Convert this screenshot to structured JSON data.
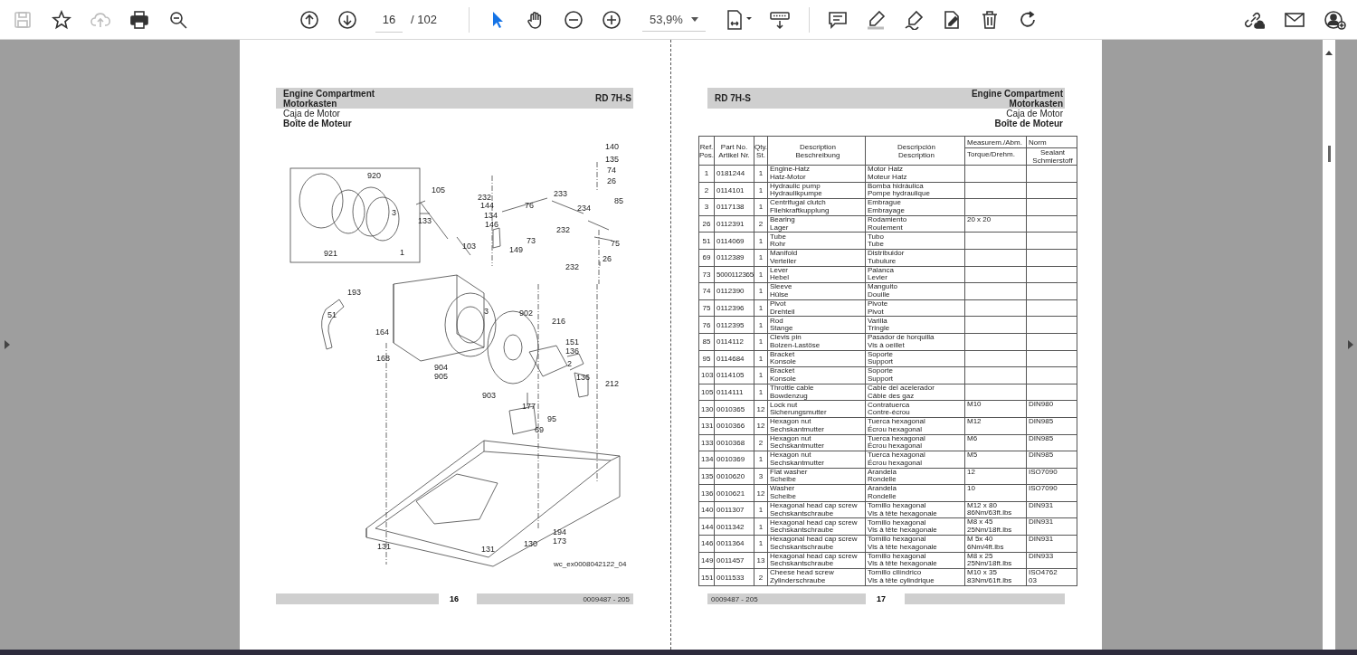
{
  "toolbar": {
    "file_tools": [
      {
        "disabled": true
      },
      {
        "disabled": false
      },
      {
        "disabled": true
      },
      {
        "disabled": false
      },
      {
        "disabled": false
      }
    ],
    "page_current": "16",
    "page_total": "/ 102",
    "pointer_tools": [
      {
        "selected": true
      },
      {
        "selected": false
      }
    ],
    "zoom": "53,9%"
  },
  "left_page": {
    "title_lines": [
      "Engine Compartment",
      "Motorkasten"
    ],
    "model": "RD 7H-S",
    "subtitle_lines": [
      "Caja de Motor",
      "Boîte de Moteur"
    ],
    "callouts": [
      "140",
      "135",
      "74",
      "26",
      "920",
      "105",
      "232",
      "144",
      "134",
      "146",
      "233",
      "76",
      "234",
      "85",
      "133",
      "3",
      "232",
      "73",
      "149",
      "75",
      "103",
      "921",
      "1",
      "26",
      "232",
      "193",
      "51",
      "3",
      "164",
      "902",
      "216",
      "151",
      "136",
      "2",
      "168",
      "904",
      "905",
      "136",
      "212",
      "903",
      "95",
      "177",
      "69",
      "194",
      "173",
      "131",
      "130",
      "131"
    ],
    "figure_id": "wc_ex0008042122_04",
    "page_number": "16",
    "doc_number": "0009487 - 205"
  },
  "right_page": {
    "model": "RD 7H-S",
    "title_lines": [
      "Engine Compartment",
      "Motorkasten"
    ],
    "subtitle_lines": [
      "Caja de Motor",
      "Boîte de Moteur"
    ],
    "table": {
      "columns": [
        [
          "Ref.",
          "Pos."
        ],
        [
          "Part No.",
          "Artikel Nr."
        ],
        [
          "Qty.",
          "St."
        ],
        [
          "Description",
          "Beschreibung"
        ],
        [
          "Descripción",
          "Description"
        ],
        [
          "Measurem./Abm.",
          "Torque/Drehm."
        ],
        [
          "Norm",
          "Sealant Schmierstoff"
        ]
      ],
      "rows": [
        {
          "ref": "1",
          "part": "0181244",
          "qty": "1",
          "desc": [
            "Engine-Hatz",
            "Hatz-Motor"
          ],
          "desc2": [
            "Motor Hatz",
            "Moteur Hatz"
          ],
          "meas": [],
          "norm": []
        },
        {
          "ref": "2",
          "part": "0114101",
          "qty": "1",
          "desc": [
            "Hydraulic pump",
            "Hydraulikpumpe"
          ],
          "desc2": [
            "Bomba hidráulica",
            "Pompe hydraulique"
          ],
          "meas": [],
          "norm": []
        },
        {
          "ref": "3",
          "part": "0117138",
          "qty": "1",
          "desc": [
            "Centrifugal clutch",
            "Fliehkraftkupplung"
          ],
          "desc2": [
            "Embrague",
            "Embrayage"
          ],
          "meas": [],
          "norm": []
        },
        {
          "ref": "26",
          "part": "0112391",
          "qty": "2",
          "desc": [
            "Bearing",
            "Lager"
          ],
          "desc2": [
            "Rodamiento",
            "Roulement"
          ],
          "meas": [
            "20 x 20"
          ],
          "norm": []
        },
        {
          "ref": "51",
          "part": "0114069",
          "qty": "1",
          "desc": [
            "Tube",
            "Rohr"
          ],
          "desc2": [
            "Tubo",
            "Tube"
          ],
          "meas": [],
          "norm": []
        },
        {
          "ref": "69",
          "part": "0112389",
          "qty": "1",
          "desc": [
            "Manifold",
            "Verteiler"
          ],
          "desc2": [
            "Distribuidor",
            "Tubulure"
          ],
          "meas": [],
          "norm": []
        },
        {
          "ref": "73",
          "part": "5000112365",
          "qty": "1",
          "desc": [
            "Lever",
            "Hebel"
          ],
          "desc2": [
            "Palanca",
            "Levier"
          ],
          "meas": [],
          "norm": []
        },
        {
          "ref": "74",
          "part": "0112390",
          "qty": "1",
          "desc": [
            "Sleeve",
            "Hülse"
          ],
          "desc2": [
            "Manguito",
            "Douille"
          ],
          "meas": [],
          "norm": []
        },
        {
          "ref": "75",
          "part": "0112396",
          "qty": "1",
          "desc": [
            "Pivot",
            "Drehteil"
          ],
          "desc2": [
            "Pivote",
            "Pivot"
          ],
          "meas": [],
          "norm": []
        },
        {
          "ref": "76",
          "part": "0112395",
          "qty": "1",
          "desc": [
            "Rod",
            "Stange"
          ],
          "desc2": [
            "Varilla",
            "Tringle"
          ],
          "meas": [],
          "norm": []
        },
        {
          "ref": "85",
          "part": "0114112",
          "qty": "1",
          "desc": [
            "Clevis pin",
            "Bolzen-Lastöse"
          ],
          "desc2": [
            "Pasador de horquilla",
            "Vis à oeillet"
          ],
          "meas": [],
          "norm": []
        },
        {
          "ref": "95",
          "part": "0114684",
          "qty": "1",
          "desc": [
            "Bracket",
            "Konsole"
          ],
          "desc2": [
            "Soporte",
            "Support"
          ],
          "meas": [],
          "norm": []
        },
        {
          "ref": "103",
          "part": "0114105",
          "qty": "1",
          "desc": [
            "Bracket",
            "Konsole"
          ],
          "desc2": [
            "Soporte",
            "Support"
          ],
          "meas": [],
          "norm": []
        },
        {
          "ref": "105",
          "part": "0114111",
          "qty": "1",
          "desc": [
            "Throttle cable",
            "Bowdenzug"
          ],
          "desc2": [
            "Cable del acelerador",
            "Câble des gaz"
          ],
          "meas": [],
          "norm": []
        },
        {
          "ref": "130",
          "part": "0010365",
          "qty": "12",
          "desc": [
            "Lock nut",
            "Sicherungsmutter"
          ],
          "desc2": [
            "Contratuerca",
            "Contre-écrou"
          ],
          "meas": [
            "M10"
          ],
          "norm": [
            "DIN980"
          ]
        },
        {
          "ref": "131",
          "part": "0010366",
          "qty": "12",
          "desc": [
            "Hexagon nut",
            "Sechskantmutter"
          ],
          "desc2": [
            "Tuerca hexagonal",
            "Écrou hexagonal"
          ],
          "meas": [
            "M12"
          ],
          "norm": [
            "DIN985"
          ]
        },
        {
          "ref": "133",
          "part": "0010368",
          "qty": "2",
          "desc": [
            "Hexagon nut",
            "Sechskantmutter"
          ],
          "desc2": [
            "Tuerca hexagonal",
            "Écrou hexagonal"
          ],
          "meas": [
            "M6"
          ],
          "norm": [
            "DIN985"
          ]
        },
        {
          "ref": "134",
          "part": "0010369",
          "qty": "1",
          "desc": [
            "Hexagon nut",
            "Sechskantmutter"
          ],
          "desc2": [
            "Tuerca hexagonal",
            "Écrou hexagonal"
          ],
          "meas": [
            "M5"
          ],
          "norm": [
            "DIN985"
          ]
        },
        {
          "ref": "135",
          "part": "0010620",
          "qty": "3",
          "desc": [
            "Flat washer",
            "Scheibe"
          ],
          "desc2": [
            "Arandela",
            "Rondelle"
          ],
          "meas": [
            "12"
          ],
          "norm": [
            "ISO7090"
          ]
        },
        {
          "ref": "136",
          "part": "0010621",
          "qty": "12",
          "desc": [
            "Washer",
            "Scheibe"
          ],
          "desc2": [
            "Arandela",
            "Rondelle"
          ],
          "meas": [
            "10"
          ],
          "norm": [
            "ISO7090"
          ]
        },
        {
          "ref": "140",
          "part": "0011307",
          "qty": "1",
          "desc": [
            "Hexagonal head cap screw",
            "Sechskantschraube"
          ],
          "desc2": [
            "Tornillo hexagonal",
            "Vis à tête hexagonale"
          ],
          "meas": [
            "M12 x 80",
            "86Nm/63ft.lbs"
          ],
          "norm": [
            "DIN931"
          ]
        },
        {
          "ref": "144",
          "part": "0011342",
          "qty": "1",
          "desc": [
            "Hexagonal head cap screw",
            "Sechskantschraube"
          ],
          "desc2": [
            "Tornillo hexagonal",
            "Vis à tête hexagonale"
          ],
          "meas": [
            "M8 x 45",
            "25Nm/18ft.lbs"
          ],
          "norm": [
            "DIN931"
          ]
        },
        {
          "ref": "146",
          "part": "0011364",
          "qty": "1",
          "desc": [
            "Hexagonal head cap screw",
            "Sechskantschraube"
          ],
          "desc2": [
            "Tornillo hexagonal",
            "Vis à tête hexagonale"
          ],
          "meas": [
            "M 5x 40",
            "6Nm/4ft.lbs"
          ],
          "norm": [
            "DIN931"
          ]
        },
        {
          "ref": "149",
          "part": "0011457",
          "qty": "13",
          "desc": [
            "Hexagonal head cap screw",
            "Sechskantschraube"
          ],
          "desc2": [
            "Tornillo hexagonal",
            "Vis à tête hexagonale"
          ],
          "meas": [
            "M8 x 25",
            "25Nm/18ft.lbs"
          ],
          "norm": [
            "DIN933"
          ]
        },
        {
          "ref": "151",
          "part": "0011533",
          "qty": "2",
          "desc": [
            "Cheese head screw",
            "Zylinderschraube"
          ],
          "desc2": [
            "Tornillo cilíndrico",
            "Vis à tête cylindrique"
          ],
          "meas": [
            "M10 x 35",
            "83Nm/61ft.lbs"
          ],
          "norm": [
            "ISO4762",
            "03"
          ]
        }
      ]
    },
    "doc_number": "0009487 - 205",
    "page_number": "17"
  }
}
